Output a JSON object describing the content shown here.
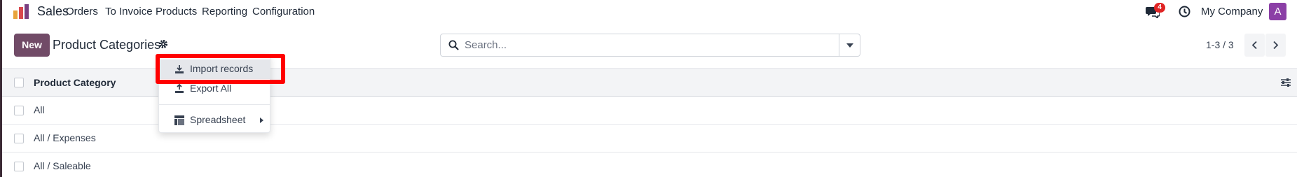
{
  "app": {
    "name": "Sales",
    "accent_color": "#714b67"
  },
  "topbar": {
    "menu": [
      "Orders",
      "To Invoice",
      "Products",
      "Reporting",
      "Configuration"
    ],
    "chat_count": "4",
    "company": "My Company",
    "avatar_letter": "A"
  },
  "control_panel": {
    "new_label": "New",
    "title": "Product Categories",
    "search_placeholder": "Search...",
    "pager": "1-3 / 3"
  },
  "list": {
    "column_header": "Product Category",
    "rows": [
      "All",
      "All / Expenses",
      "All / Saleable"
    ]
  },
  "dropdown": {
    "items": [
      {
        "label": "Import records",
        "icon": "download-icon"
      },
      {
        "label": "Export All",
        "icon": "upload-icon"
      },
      {
        "label": "Spreadsheet",
        "icon": "spreadsheet-icon"
      }
    ]
  },
  "highlight": {
    "color": "#ff0000",
    "target": "Import records"
  },
  "icons": {
    "logo": "sales-logo-icon",
    "chat": "chat-icon",
    "clock": "clock-icon",
    "gear": "gear-icon",
    "search": "search-icon",
    "prev": "chevron-left-icon",
    "next": "chevron-right-icon",
    "optional_columns": "sliders-icon"
  }
}
